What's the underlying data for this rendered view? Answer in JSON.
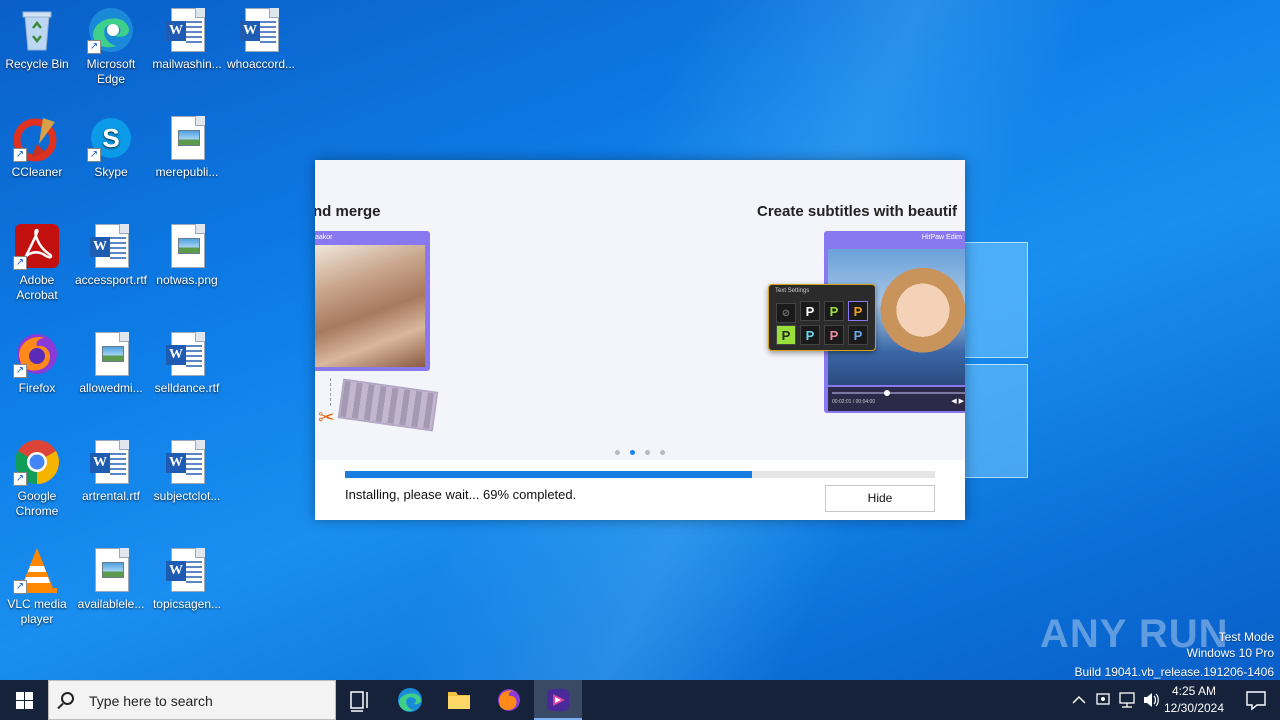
{
  "desktop": {
    "icons": [
      {
        "label": "Recycle Bin"
      },
      {
        "label": "Microsoft Edge"
      },
      {
        "label": "mailwashin..."
      },
      {
        "label": "whoaccord..."
      },
      {
        "label": "CCleaner"
      },
      {
        "label": "Skype"
      },
      {
        "label": "merepubli..."
      },
      {
        "label": "Adobe Acrobat"
      },
      {
        "label": "accessport.rtf"
      },
      {
        "label": "notwas.png"
      },
      {
        "label": "Firefox"
      },
      {
        "label": "allowedmi..."
      },
      {
        "label": "selldance.rtf"
      },
      {
        "label": "Google Chrome"
      },
      {
        "label": "artrental.rtf"
      },
      {
        "label": "subjectclot..."
      },
      {
        "label": "VLC media player"
      },
      {
        "label": "availablele..."
      },
      {
        "label": "topicsagen..."
      }
    ]
  },
  "installer": {
    "slide_left_title": "nd merge",
    "slide_right_title": "Create subtitles with beautif",
    "left_frame_title": "aakor",
    "right_frame_title": "HitPaw Edim",
    "text_settings_title": "Text Settings",
    "swatch_letter": "P",
    "player_time": "00:02:01 / 00:04:00",
    "progress_percent": 69,
    "status": "Installing, please wait... 69% completed.",
    "hide_label": "Hide",
    "active_dot": 1,
    "dot_count": 4
  },
  "watermark": {
    "brand": "ANY RUN",
    "mode": "Test Mode",
    "os": "Windows 10 Pro",
    "build": "Build 19041.vb_release.191206-1406"
  },
  "taskbar": {
    "search_placeholder": "Type here to search",
    "time": "4:25 AM",
    "date": "12/30/2024"
  },
  "colors": {
    "accent": "#1a7ee0",
    "taskbar": "#15223a"
  }
}
